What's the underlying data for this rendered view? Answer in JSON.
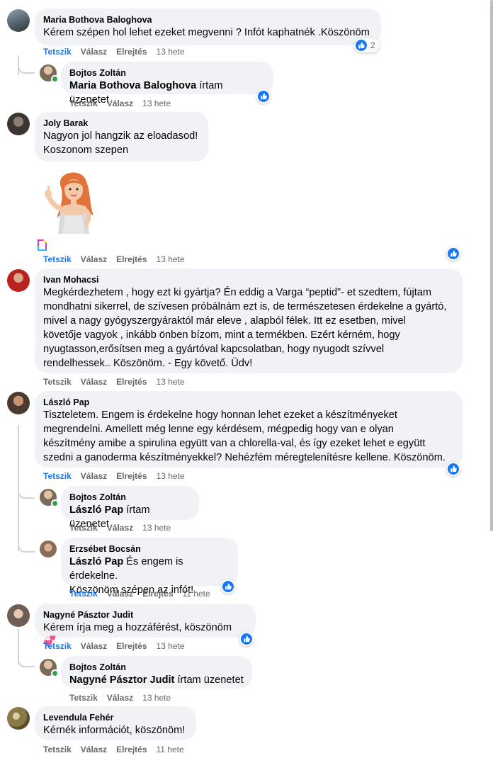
{
  "actions": {
    "like": "Tetszik",
    "reply": "Válasz",
    "hide": "Elrejtés"
  },
  "comments": [
    {
      "author": "Maria Bothova Baloghova",
      "text": "Kérem szépen hol lehet ezeket megvenni ? Infót kaphatnék .Köszönöm",
      "time": "13 hete",
      "reaction_count": "2"
    },
    {
      "author": "Bojtos Zoltán",
      "mention": "Maria Bothova Baloghova",
      "text": "írtam üzenetet",
      "time": "13 hete"
    },
    {
      "author": "Joly Barak",
      "text": "Nagyon jol hangzik az eloadasod!\nKoszonom szepen",
      "time": "13 hete",
      "sticker": "redhead-woman-thumbs-up-sticker"
    },
    {
      "author": "Ivan Mohacsi",
      "text": "Megkérdezhetem , hogy ezt ki gyártja? Én eddig a Varga “peptid”- et szedtem, fújtam\nmondhatni sikerrel, de szívesen próbálnám ezt is, de természetesen érdekelne a gyártó,\nmivel a nagy gyógyszergyáraktól már eleve , alapból félek. Itt ez esetben, mivel\nkövetője vagyok , inkább önben bízom, mint a termékben. Ezért kérném, hogy\nnyugtasson,erősítsen meg a gyártóval kapcsolatban, hogy nyugodt szívvel\nrendelhessek.. Köszönöm. - Egy követő. Üdv!",
      "time": "13 hete"
    },
    {
      "author": "László Pap",
      "text": "Tiszteletem. Engem is érdekelne hogy honnan lehet ezeket a készítményeket\nmegrendelni. Amellett még lenne egy kérdésem, mégpedig hogy van e olyan\nkészítmény amibe a spirulina együtt van a chlorella-val, és így ezeket lehet e együtt\nszedni a ganoderma készítményekkel? Nehézfém méregtelenítésre kellene. Köszönöm.",
      "time": "13 hete"
    },
    {
      "author": "Bojtos Zoltán",
      "mention": "László Pap",
      "text": "írtam üzenetet",
      "time": "13 hete"
    },
    {
      "author": "Erzsébet Bocsán",
      "mention": "László Pap",
      "text": "És engem is érdekelne.",
      "text2": "Köszönöm szépen az infót!",
      "time": "11 hete"
    },
    {
      "author": "Nagyné Pásztor Judit",
      "text": "Kérem írja meg a hozzáférést, köszönöm",
      "emoji": "💞",
      "time": "13 hete"
    },
    {
      "author": "Bojtos Zoltán",
      "mention": "Nagyné Pásztor Judit",
      "text": "írtam üzenetet",
      "time": "13 hete"
    },
    {
      "author": "Levendula Fehér",
      "text": "Kérnék információt, köszönöm!",
      "time": "11 hete"
    }
  ],
  "colors": {
    "bubble": "#f0f2f5",
    "link": "#1877f2",
    "meta": "#65676b",
    "online": "#31a24c"
  }
}
